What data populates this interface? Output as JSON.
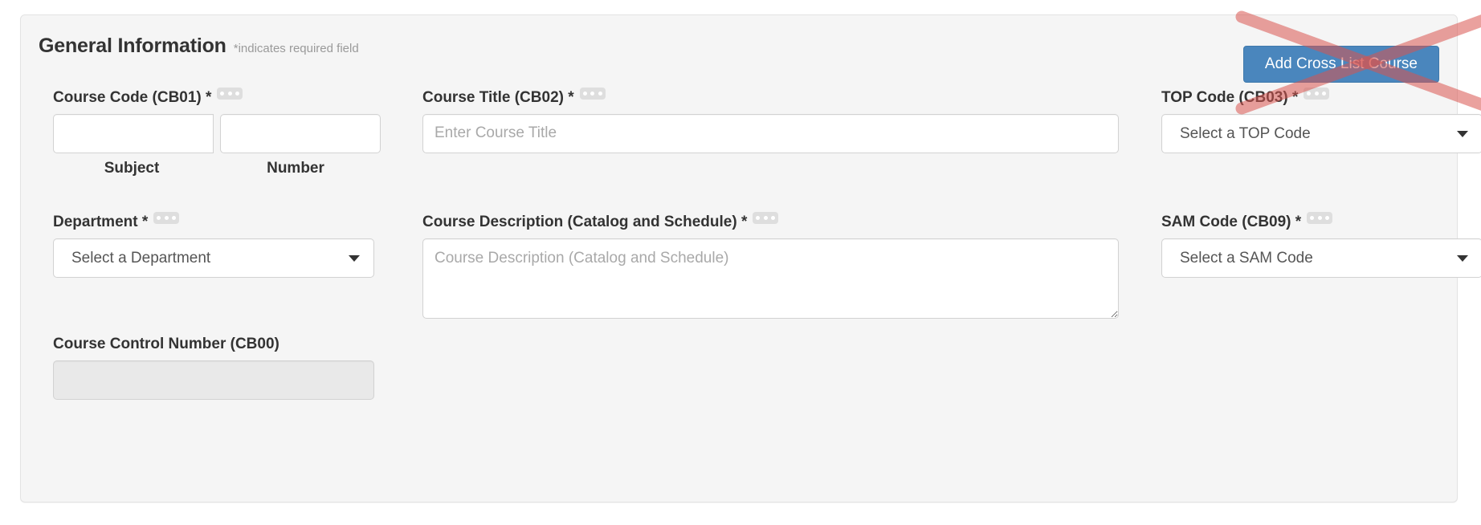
{
  "panel": {
    "title": "General Information",
    "required_note": "*indicates required field",
    "action_button": "Add Cross List Course"
  },
  "fields": {
    "course_code": {
      "label": "Course Code (CB01) *",
      "badge": "ellipsis-icon",
      "subject_value": "",
      "number_value": "",
      "subject_sublabel": "Subject",
      "number_sublabel": "Number"
    },
    "course_title": {
      "label": "Course Title (CB02) *",
      "badge": "ellipsis-icon",
      "placeholder": "Enter Course Title",
      "value": ""
    },
    "top_code": {
      "label": "TOP Code (CB03) *",
      "badge": "ellipsis-icon",
      "selected": "Select a TOP Code"
    },
    "department": {
      "label": "Department *",
      "badge": "ellipsis-icon",
      "selected": "Select a Department"
    },
    "course_description": {
      "label": "Course Description (Catalog and Schedule) *",
      "badge": "ellipsis-icon",
      "placeholder": "Course Description (Catalog and Schedule)",
      "value": ""
    },
    "sam_code": {
      "label": "SAM Code (CB09) *",
      "badge": "ellipsis-icon",
      "selected": "Select a SAM Code"
    },
    "course_control_number": {
      "label": "Course Control Number (CB00)",
      "value": "",
      "disabled": true
    }
  },
  "annotation": {
    "type": "red-x-strikeout",
    "target": "Add Cross List Course",
    "color": "#d9534f"
  },
  "colors": {
    "panel_background": "#f5f5f5",
    "panel_border": "#e3e3e3",
    "primary_button": "#4a86bd",
    "label_text": "#333333",
    "placeholder_text": "#a9a9a9",
    "muted_text": "#9a9a9a",
    "badge_background": "#dedede",
    "disabled_input": "#e9e9e9",
    "annotation_red": "#d9534f"
  }
}
